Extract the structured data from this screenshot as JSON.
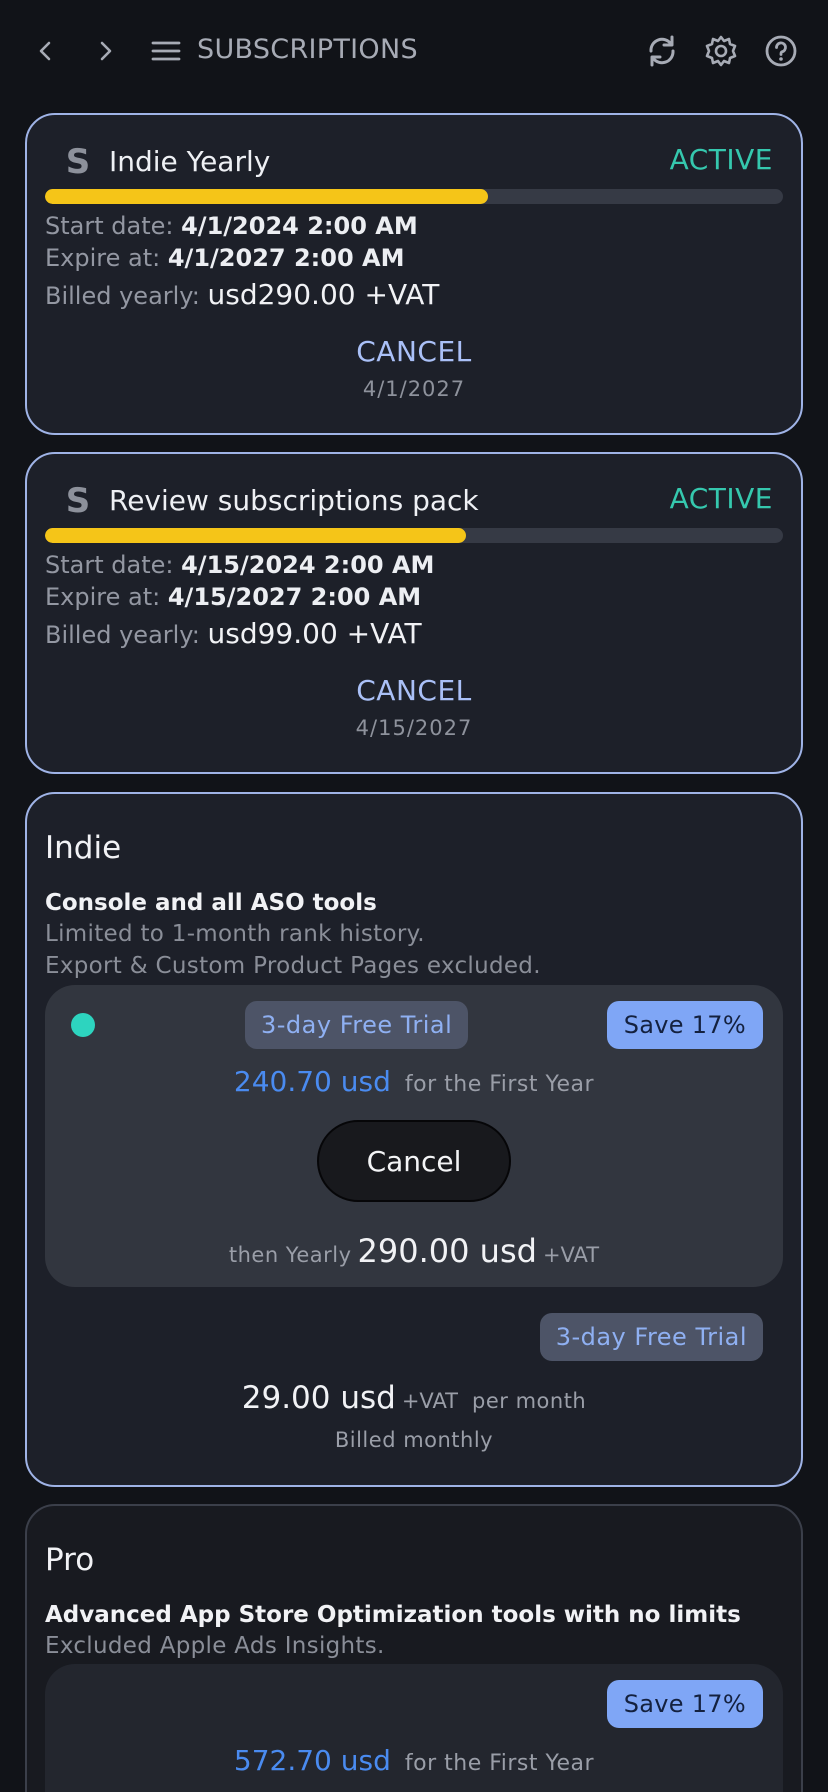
{
  "header": {
    "title": "SUBSCRIPTIONS",
    "icons": [
      "back-icon",
      "forward-icon",
      "menu-icon",
      "refresh-icon",
      "settings-icon",
      "help-icon"
    ]
  },
  "subscriptions": [
    {
      "logo": "S",
      "name": "Indie Yearly",
      "status": "ACTIVE",
      "progress": 0.6,
      "start_label": "Start date:",
      "start_value": "4/1/2024 2:00 AM",
      "expire_label": "Expire at:",
      "expire_value": "4/1/2027 2:00 AM",
      "billed_label": "Billed yearly:",
      "billed_value": "usd290.00 +VAT",
      "cancel_label": "CANCEL",
      "cancel_date": "4/1/2027"
    },
    {
      "logo": "S",
      "name": "Review subscriptions pack",
      "status": "ACTIVE",
      "progress": 0.57,
      "start_label": "Start date:",
      "start_value": "4/15/2024 2:00 AM",
      "expire_label": "Expire at:",
      "expire_value": "4/15/2027 2:00 AM",
      "billed_label": "Billed yearly:",
      "billed_value": "usd99.00 +VAT",
      "cancel_label": "CANCEL",
      "cancel_date": "4/15/2027"
    }
  ],
  "plans": {
    "indie": {
      "title": "Indie",
      "subtitle": "Console and all ASO tools",
      "notes": [
        "Limited to 1-month rank history.",
        "Export & Custom Product Pages excluded."
      ],
      "yearly_offer": {
        "trial": "3-day Free Trial",
        "save": "Save 17%",
        "first_year_amount": "240.70 usd",
        "first_year_label": "for the First Year",
        "cancel_button": "Cancel",
        "then_label": "then Yearly",
        "then_amount": "290.00 usd",
        "then_vat": "+VAT"
      },
      "monthly_offer": {
        "trial": "3-day Free Trial",
        "amount": "29.00 usd",
        "vat": "+VAT",
        "per": "per month",
        "billed": "Billed monthly"
      }
    },
    "pro": {
      "title": "Pro",
      "subtitle": "Advanced App Store Optimization tools with no limits",
      "note": "Excluded Apple Ads Insights.",
      "yearly_offer": {
        "save": "Save 17%",
        "first_year_amount": "572.70 usd",
        "first_year_label": "for the First Year"
      }
    }
  },
  "colors": {
    "active": "#35c8ae",
    "progress": "#f5c518",
    "link": "#aac0f7",
    "price_accent": "#4a8bf0",
    "save_badge": "#7fa6f6"
  }
}
